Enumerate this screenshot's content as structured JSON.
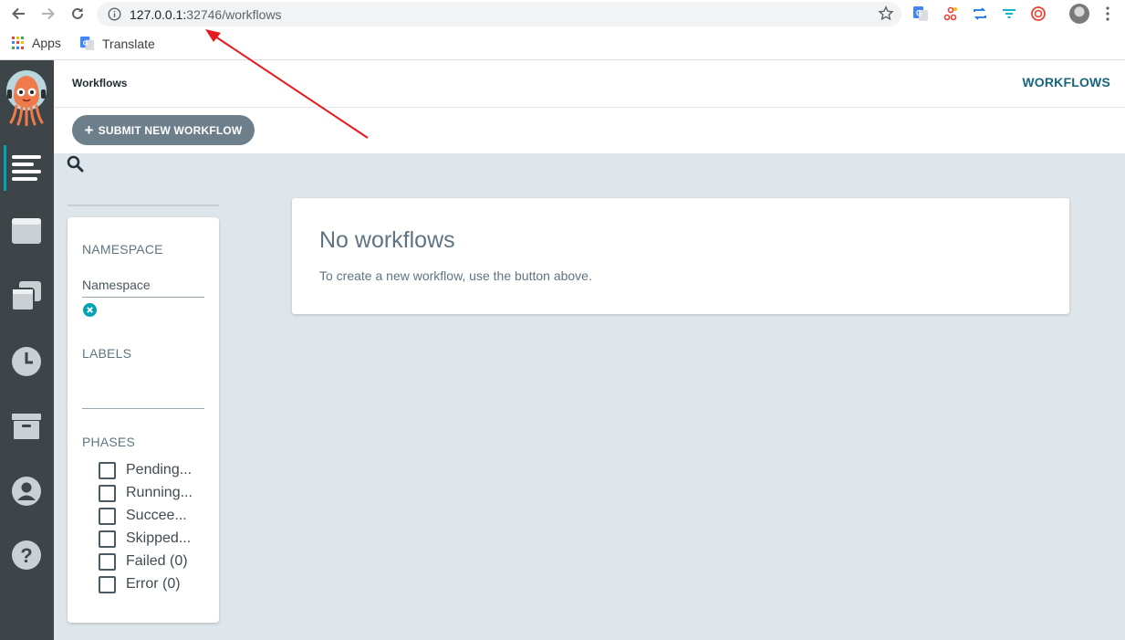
{
  "browser": {
    "url_host": "127.0.0.1:",
    "url_rest": "32746/workflows",
    "bookmarks": [
      {
        "label": "Apps"
      },
      {
        "label": "Translate"
      }
    ]
  },
  "header": {
    "breadcrumb": "Workflows",
    "title": "WORKFLOWS"
  },
  "toolbar": {
    "submit_label": "SUBMIT NEW WORKFLOW"
  },
  "filters": {
    "namespace_heading": "NAMESPACE",
    "namespace_placeholder": "Namespace",
    "labels_heading": "LABELS",
    "phases_heading": "PHASES",
    "phases": [
      {
        "label": "Pending..."
      },
      {
        "label": "Running..."
      },
      {
        "label": "Succee..."
      },
      {
        "label": "Skipped..."
      },
      {
        "label": "Failed (0)"
      },
      {
        "label": "Error (0)"
      }
    ]
  },
  "empty_state": {
    "title": "No workflows",
    "message": "To create a new workflow, use the button above."
  },
  "nav_icons": [
    "workflows-icon",
    "workflow-templates-icon",
    "cluster-workflow-templates-icon",
    "cron-workflows-icon",
    "archived-workflows-icon",
    "user-icon",
    "help-icon"
  ],
  "colors": {
    "accent": "#17657d",
    "nav_background": "#3d4549",
    "active_indicator": "#00a2b3",
    "button": "#6d7f8b",
    "content_background": "#dee6ec",
    "annotation_arrow": "#e8191c"
  }
}
